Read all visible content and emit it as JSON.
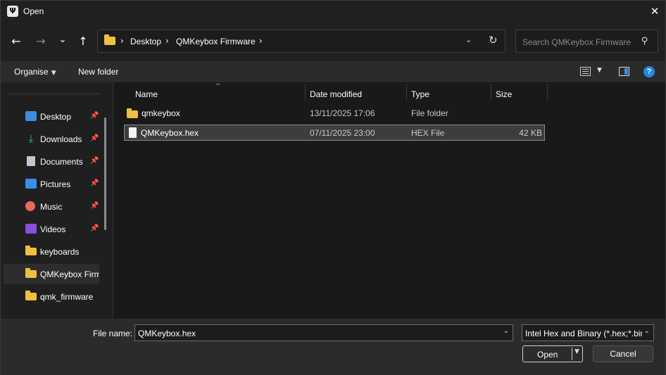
{
  "window": {
    "title": "Open",
    "close_glyph": "✕",
    "app_icon_glyph": "Ψ"
  },
  "nav": {
    "back": "←",
    "forward": "→",
    "recent": "⌄",
    "up": "↑",
    "breadcrumb": [
      "Desktop",
      "QMKeybox Firmware"
    ],
    "breadcrumb_sep": "›",
    "dropdown": "⌄",
    "refresh": "↻",
    "search_placeholder": "Search QMKeybox Firmware"
  },
  "commands": {
    "organise": "Organise",
    "new_folder": "New folder",
    "help": "?"
  },
  "sidebar": {
    "items": [
      {
        "label": "Desktop",
        "icon": "desktop-icon",
        "pinned": true
      },
      {
        "label": "Downloads",
        "icon": "downloads-icon",
        "pinned": true
      },
      {
        "label": "Documents",
        "icon": "documents-icon",
        "pinned": true
      },
      {
        "label": "Pictures",
        "icon": "pictures-icon",
        "pinned": true
      },
      {
        "label": "Music",
        "icon": "music-icon",
        "pinned": true
      },
      {
        "label": "Videos",
        "icon": "videos-icon",
        "pinned": true
      },
      {
        "label": "keyboards",
        "icon": "folder-icon",
        "pinned": false
      },
      {
        "label": "QMKeybox Firmware",
        "icon": "folder-icon",
        "pinned": false,
        "selected": true
      },
      {
        "label": "qmk_firmware",
        "icon": "folder-icon",
        "pinned": false
      }
    ]
  },
  "files": {
    "columns": [
      "Name",
      "Date modified",
      "Type",
      "Size"
    ],
    "rows": [
      {
        "name": "qmkeybox",
        "date": "13/11/2025 17:06",
        "type": "File folder",
        "size": "",
        "kind": "folder"
      },
      {
        "name": "QMKeybox.hex",
        "date": "07/11/2025 23:00",
        "type": "HEX File",
        "size": "42 KB",
        "kind": "file",
        "selected": true
      }
    ]
  },
  "bottom": {
    "file_name_label": "File name:",
    "file_name_value": "QMKeybox.hex",
    "file_type_value": "Intel Hex and Binary (*.hex;*.bin)",
    "open_label": "Open",
    "cancel_label": "Cancel"
  }
}
